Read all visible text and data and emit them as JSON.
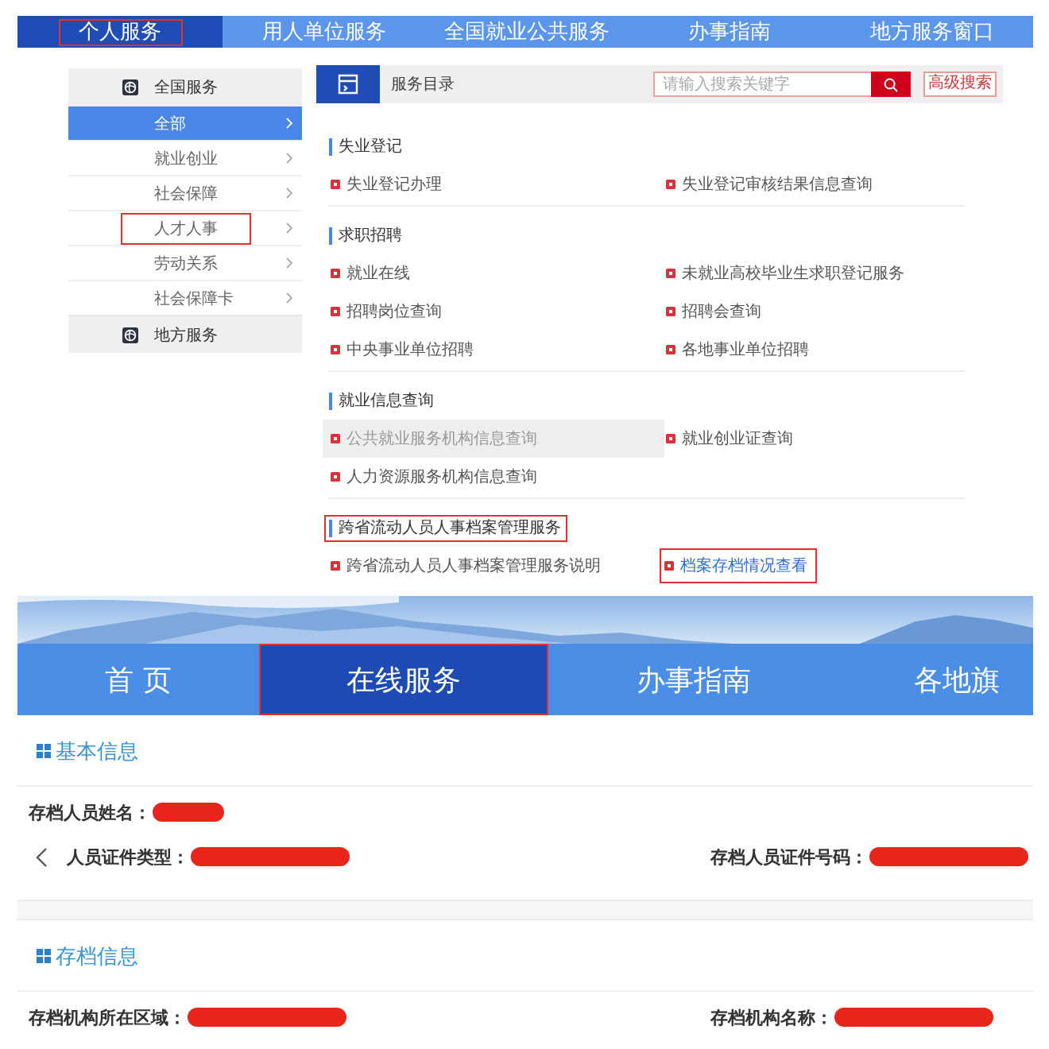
{
  "portal": {
    "nav": [
      {
        "label": "个人服务",
        "selected": true,
        "marked": true
      },
      {
        "label": "用人单位服务",
        "selected": false,
        "marked": false
      },
      {
        "label": "全国就业公共服务",
        "selected": false,
        "marked": false
      },
      {
        "label": "办事指南",
        "selected": false,
        "marked": false
      },
      {
        "label": "地方服务窗口",
        "selected": false,
        "marked": false
      }
    ],
    "sidebar": [
      {
        "title": "全国服务",
        "items": [
          {
            "label": "全部",
            "selected": true,
            "marked": false
          },
          {
            "label": "就业创业",
            "selected": false,
            "marked": false
          },
          {
            "label": "社会保障",
            "selected": false,
            "marked": false
          },
          {
            "label": "人才人事",
            "selected": false,
            "marked": true
          },
          {
            "label": "劳动关系",
            "selected": false,
            "marked": false
          },
          {
            "label": "社会保障卡",
            "selected": false,
            "marked": false
          }
        ]
      },
      {
        "title": "地方服务"
      }
    ],
    "catalog": {
      "title": "服务目录",
      "search": {
        "placeholder": "请输入搜索关键字"
      },
      "advanced_search": "高级搜索",
      "sections": [
        {
          "title": "失业登记",
          "marked": false,
          "items": [
            {
              "label": "失业登记办理",
              "hovered": false,
              "active": false,
              "marked": false
            },
            {
              "label": "失业登记审核结果信息查询",
              "hovered": false,
              "active": false,
              "marked": false
            }
          ]
        },
        {
          "title": "求职招聘",
          "marked": false,
          "items": [
            {
              "label": "就业在线",
              "hovered": false,
              "active": false,
              "marked": false
            },
            {
              "label": "未就业高校毕业生求职登记服务",
              "hovered": false,
              "active": false,
              "marked": false
            },
            {
              "label": "招聘岗位查询",
              "hovered": false,
              "active": false,
              "marked": false
            },
            {
              "label": "招聘会查询",
              "hovered": false,
              "active": false,
              "marked": false
            },
            {
              "label": "中央事业单位招聘",
              "hovered": false,
              "active": false,
              "marked": false
            },
            {
              "label": "各地事业单位招聘",
              "hovered": false,
              "active": false,
              "marked": false
            }
          ]
        },
        {
          "title": "就业信息查询",
          "marked": false,
          "items": [
            {
              "label": "公共就业服务机构信息查询",
              "hovered": true,
              "active": false,
              "marked": false
            },
            {
              "label": "就业创业证查询",
              "hovered": false,
              "active": false,
              "marked": false
            },
            {
              "label": "人力资源服务机构信息查询",
              "hovered": false,
              "active": false,
              "marked": false
            }
          ]
        },
        {
          "title": "跨省流动人员人事档案管理服务",
          "marked": true,
          "items": [
            {
              "label": "跨省流动人员人事档案管理服务说明",
              "hovered": false,
              "active": false,
              "marked": false
            },
            {
              "label": "档案存档情况查看",
              "hovered": false,
              "active": true,
              "marked": true
            }
          ]
        }
      ]
    }
  },
  "archive": {
    "nav": [
      {
        "label": "首 页",
        "selected": false,
        "marked": false
      },
      {
        "label": "在线服务",
        "selected": true,
        "marked": true
      },
      {
        "label": "办事指南",
        "selected": false,
        "marked": false
      },
      {
        "label": "各地旗",
        "selected": false,
        "marked": false
      }
    ],
    "sections": [
      {
        "title": "基本信息",
        "rows": [
          {
            "back_arrow": false,
            "fields": [
              {
                "label": "存档人员姓名：",
                "redacted": true
              }
            ]
          },
          {
            "back_arrow": true,
            "fields": [
              {
                "label": "人员证件类型：",
                "redacted": true
              },
              {
                "label": "存档人员证件号码：",
                "redacted": true
              }
            ]
          }
        ]
      },
      {
        "title": "存档信息",
        "rows": [
          {
            "back_arrow": false,
            "fields": [
              {
                "label": "存档机构所在区域：",
                "redacted": true
              },
              {
                "label": "存档机构名称：",
                "redacted": true
              }
            ]
          }
        ]
      }
    ]
  }
}
